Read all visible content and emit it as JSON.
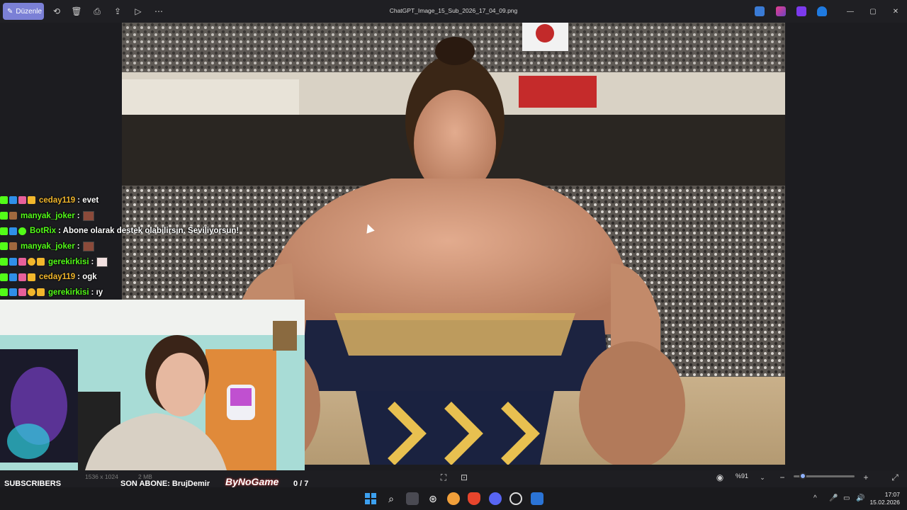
{
  "toolbar": {
    "edit_label": "Düzenle",
    "file_title": "ChatGPT_Image_15_Sub_2026_17_04_09.png",
    "icons": [
      "rotate-icon",
      "delete-icon",
      "print-icon",
      "share-icon",
      "slideshow-icon",
      "more-icon"
    ]
  },
  "chat": {
    "lines": [
      {
        "user": "ceday119",
        "user_color": "#f2b72c",
        "message": ": evet",
        "has_emote": false
      },
      {
        "user": "manyak_joker",
        "user_color": "#53fc18",
        "message": ":",
        "has_emote": true
      },
      {
        "user": "BotRix",
        "user_color": "#53fc18",
        "message": ": Abone olarak destek olabilirsin. Seviliyorsun!",
        "has_emote": false
      },
      {
        "user": "manyak_joker",
        "user_color": "#53fc18",
        "message": ":",
        "has_emote": true
      },
      {
        "user": "gerekirkisi",
        "user_color": "#53fc18",
        "message": ":",
        "has_emote": true
      },
      {
        "user": "ceday119",
        "user_color": "#f2b72c",
        "message": ": ogk",
        "has_emote": false
      },
      {
        "user": "gerekirkisi",
        "user_color": "#53fc18",
        "message": ": ıy",
        "has_emote": false
      }
    ]
  },
  "image_meta": {
    "dimensions": "1536 x 1024",
    "size": "2 MB"
  },
  "stream": {
    "subscribers_label": "SUBSCRIBERS",
    "last_sub": "SON ABONE: BrujDemir",
    "brand": "ByNoGame",
    "sub_count": "0 / 7",
    "sub_progress": 0
  },
  "viewer": {
    "zoom": "%91",
    "zoom_slider": 0.15
  },
  "clock": {
    "time": "17:07",
    "date": "15.02.2026"
  }
}
